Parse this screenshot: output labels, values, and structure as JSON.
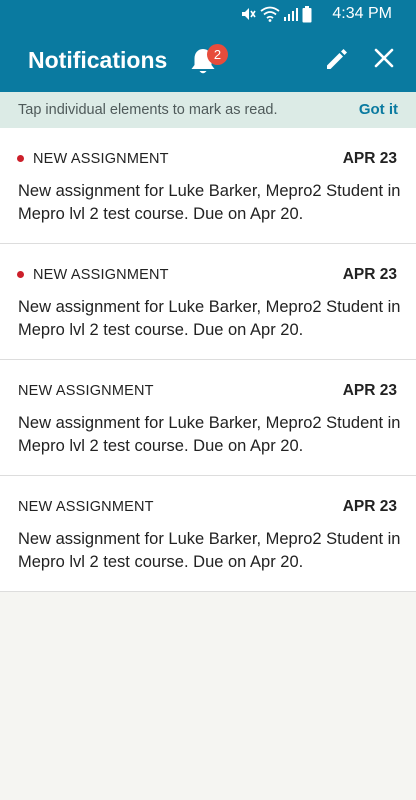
{
  "status_bar": {
    "time": "4:34 PM",
    "icons": [
      "mute-icon",
      "wifi-icon",
      "signal-icon",
      "battery-icon"
    ]
  },
  "header": {
    "title": "Notifications",
    "badge_count": "2",
    "icons": [
      "bell-icon",
      "pencil-icon",
      "close-icon"
    ]
  },
  "hint": {
    "text": "Tap individual elements to mark as read.",
    "action": "Got it"
  },
  "notifications": [
    {
      "type": "NEW ASSIGNMENT",
      "date": "APR 23",
      "body": "New assignment for Luke Barker, Mepro2 Student in Mepro lvl 2 test course. Due on Apr 20.",
      "unread": true
    },
    {
      "type": "NEW ASSIGNMENT",
      "date": "APR 23",
      "body": "New assignment for Luke Barker, Mepro2 Student in Mepro lvl 2 test course. Due on Apr 20.",
      "unread": true
    },
    {
      "type": "NEW ASSIGNMENT",
      "date": "APR 23",
      "body": "New assignment for Luke Barker, Mepro2 Student in Mepro lvl 2 test course. Due on Apr 20.",
      "unread": false
    },
    {
      "type": "NEW ASSIGNMENT",
      "date": "APR 23",
      "body": "New assignment for Luke Barker, Mepro2 Student in Mepro lvl 2 test course. Due on Apr 20.",
      "unread": false
    }
  ],
  "colors": {
    "primary": "#0a7aa0",
    "hint_background": "#dcebe6",
    "badge": "#e74c3c",
    "unread_dot": "#cc1f2a",
    "page_background": "#f5f5f2"
  }
}
